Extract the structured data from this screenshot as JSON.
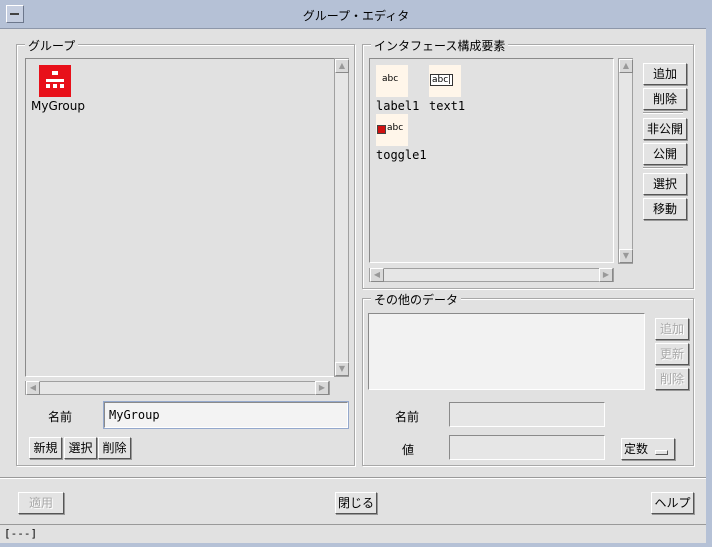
{
  "window": {
    "title": "グループ・エディタ"
  },
  "group_panel": {
    "legend": "グループ",
    "items": [
      {
        "label": "MyGroup"
      }
    ],
    "name_label": "名前",
    "name_value": "MyGroup",
    "buttons": {
      "new": "新規",
      "select": "選択",
      "delete": "削除"
    }
  },
  "interface_panel": {
    "legend": "インタフェース構成要素",
    "items": [
      {
        "label": "label1",
        "icon": "label-icon",
        "icon_text": "abc"
      },
      {
        "label": "text1",
        "icon": "text-field-icon",
        "icon_text": "abc|"
      },
      {
        "label": "toggle1",
        "icon": "toggle-icon",
        "icon_text": "abc"
      }
    ],
    "buttons": {
      "add": "追加",
      "delete": "削除",
      "hide": "非公開",
      "publish": "公開",
      "select": "選択",
      "move": "移動"
    }
  },
  "other_data_panel": {
    "legend": "その他のデータ",
    "buttons": {
      "add": "追加",
      "update": "更新",
      "delete": "削除"
    },
    "name_label": "名前",
    "name_value": "",
    "value_label": "値",
    "value_value": "",
    "type_option": "定数"
  },
  "footer": {
    "apply": "適用",
    "close": "閉じる",
    "help": "ヘルプ"
  },
  "status": {
    "text": "[---]"
  },
  "colors": {
    "group_icon": "#e8101a",
    "titlebar": "#b5c1d6",
    "background": "#e1e1e1"
  }
}
